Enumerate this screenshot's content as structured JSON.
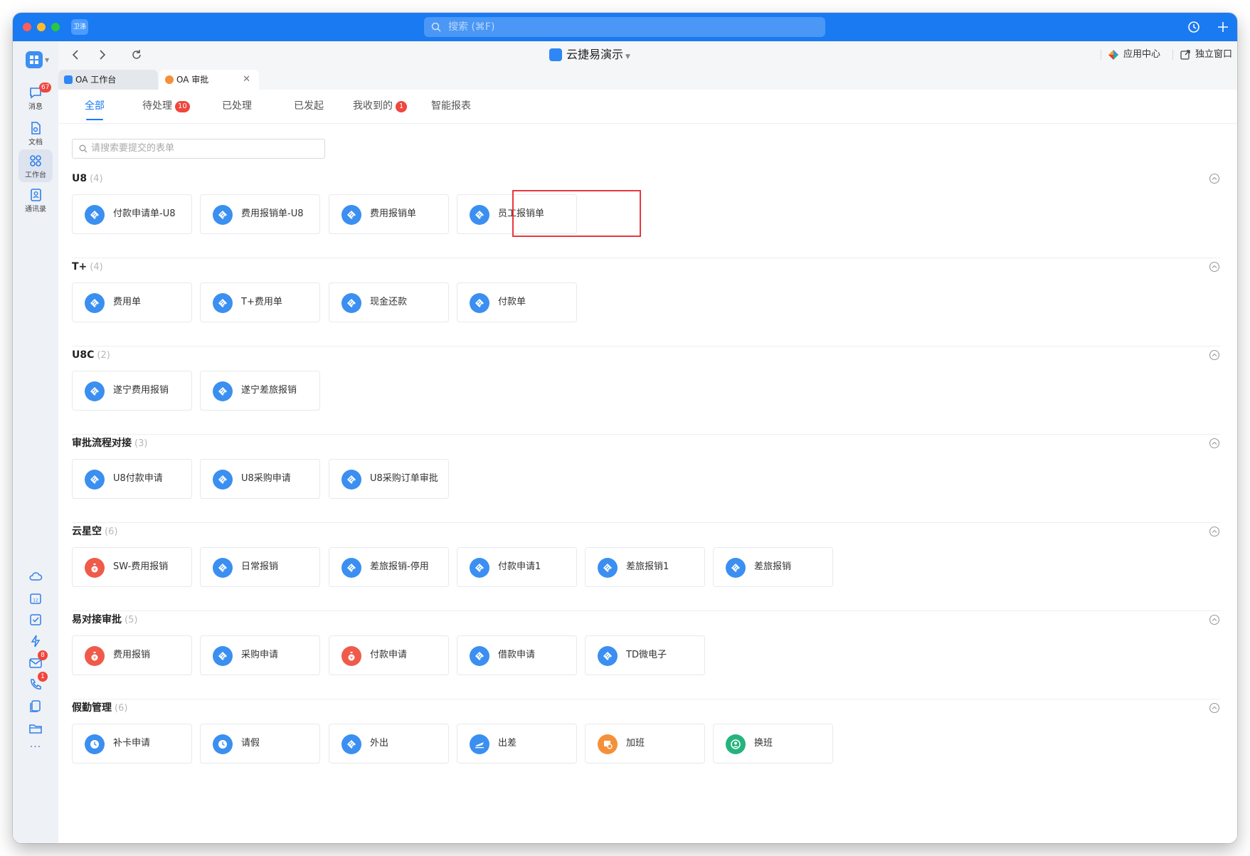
{
  "window": {
    "app_badge": "卫涤",
    "search_placeholder": "搜索 (⌘F)"
  },
  "sidebar": {
    "items": [
      {
        "label": "消息",
        "badge": "67"
      },
      {
        "label": "文档"
      },
      {
        "label": "工作台"
      },
      {
        "label": "通讯录"
      }
    ],
    "bottom_badges": {
      "mail": "8",
      "phone": "1"
    },
    "more": "···"
  },
  "navbar": {
    "workspace": "云捷易演示",
    "app_center": "应用中心",
    "standalone_window": "独立窗口"
  },
  "tabs": [
    {
      "label": "OA 工作台"
    },
    {
      "label": "OA 审批"
    }
  ],
  "subtabs": [
    {
      "label": "全部"
    },
    {
      "label": "待处理",
      "badge": "10"
    },
    {
      "label": "已处理"
    },
    {
      "label": "已发起"
    },
    {
      "label": "我收到的",
      "badge": "1"
    },
    {
      "label": "智能报表"
    }
  ],
  "form_search_placeholder": "请搜索要提交的表单",
  "sections": [
    {
      "title": "U8",
      "count": "(4)",
      "forms": [
        "付款申请单-U8",
        "费用报销单-U8",
        "费用报销单",
        "员工报销单"
      ]
    },
    {
      "title": "T+",
      "count": "(4)",
      "forms": [
        "费用单",
        "T+费用单",
        "现金还款",
        "付款单"
      ]
    },
    {
      "title": "U8C",
      "count": "(2)",
      "forms": [
        "遂宁费用报销",
        "遂宁差旅报销"
      ]
    },
    {
      "title": "审批流程对接",
      "count": "(3)",
      "forms": [
        "U8付款申请",
        "U8采购申请",
        "U8采购订单审批"
      ]
    },
    {
      "title": "云星空",
      "count": "(6)",
      "forms": [
        "SW-费用报销",
        "日常报销",
        "差旅报销-停用",
        "付款申请1",
        "差旅报销1",
        "差旅报销"
      ]
    },
    {
      "title": "易对接审批",
      "count": "(5)",
      "forms": [
        "费用报销",
        "采购申请",
        "付款申请",
        "借款申请",
        "TD微电子"
      ]
    },
    {
      "title": "假勤管理",
      "count": "(6)",
      "forms": [
        "补卡申请",
        "请假",
        "外出",
        "出差",
        "加班",
        "换班"
      ]
    }
  ],
  "colors": {
    "accent": "#1a7af2",
    "badge": "#f0463c",
    "highlight": "#e8383d"
  }
}
